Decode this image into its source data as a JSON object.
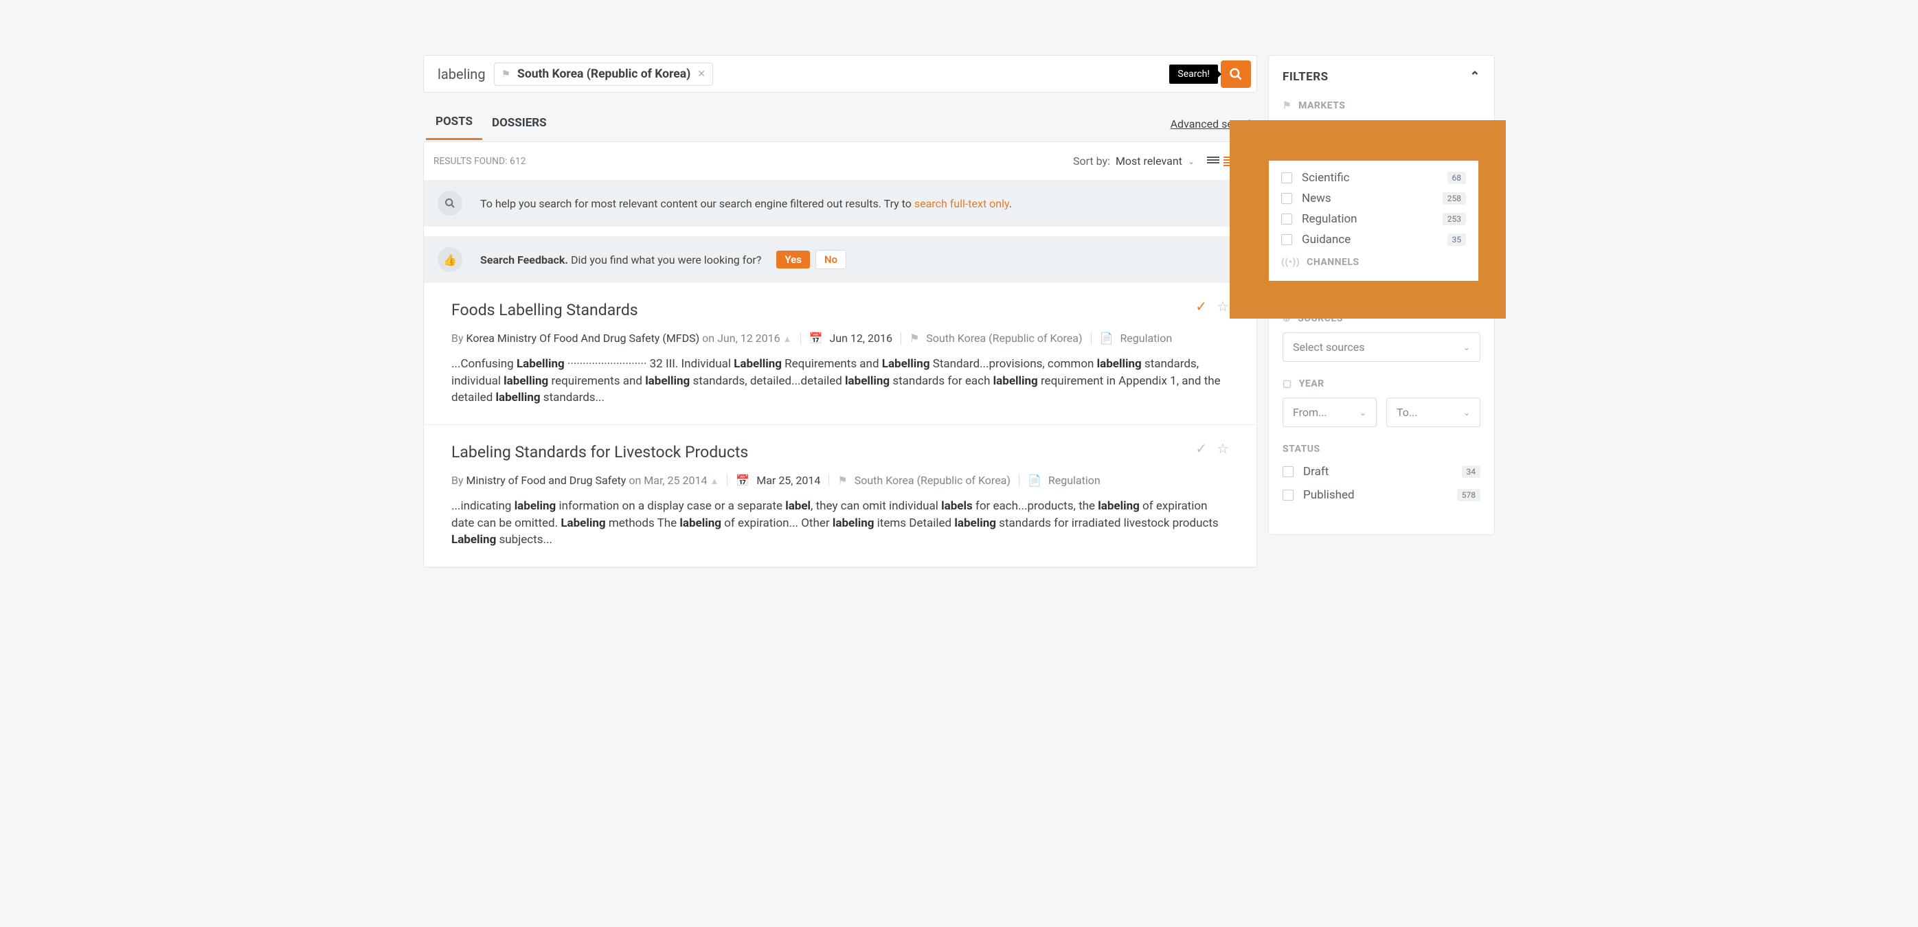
{
  "search": {
    "term": "labeling",
    "chip_label": "South Korea (Republic of Korea)",
    "tooltip": "Search!"
  },
  "tabs": {
    "posts": "POSTS",
    "dossiers": "DOSSIERS",
    "advanced": "Advanced search"
  },
  "results": {
    "found_prefix": "RESULTS FOUND: ",
    "found": "612",
    "sort_label": "Sort by:",
    "sort_value": "Most relevant"
  },
  "notice": {
    "text_a": "To help you search for most relevant content our search engine filtered out results. Try to ",
    "link": "search full-text only",
    "text_b": "."
  },
  "feedback": {
    "label_a": "Search Feedback. ",
    "label_b": "Did you find what you were looking for?",
    "yes": "Yes",
    "no": "No"
  },
  "r1": {
    "title": "Foods Labelling Standards",
    "by": "By ",
    "author": "Korea Ministry Of Food And Drug Safety (MFDS)",
    "on": " on Jun, 12 2016",
    "date": "Jun 12, 2016",
    "market": "South Korea (Republic of Korea)",
    "type": "Regulation",
    "snip": "...Confusing <b>Labelling</b> ·························· 32 III. Individual <b>Labelling</b> Requirements and <b>Labelling</b> Standard...provisions, common <b>labelling</b> standards, individual <b>labelling</b> requirements and <b>labelling</b> standards, detailed...detailed <b>labelling</b> standards for each <b>labelling</b> requirement in Appendix 1, and the detailed <b>labelling</b> standards..."
  },
  "r2": {
    "title": "Labeling Standards for Livestock Products",
    "by": "By ",
    "author": "Ministry of Food and Drug Safety",
    "on": " on Mar, 25 2014",
    "date": "Mar 25, 2014",
    "market": "South Korea (Republic of Korea)",
    "type": "Regulation",
    "snip": "...indicating <b>labeling</b> information on a display case or a separate <b>label</b>, they can omit individual <b>labels</b> for each...products, the <b>labeling</b> of expiration date can be omitted. <b>Labeling</b> methods The <b>labeling</b> of expiration... Other <b>labeling</b> items Detailed <b>labeling</b> standards for irradiated livestock products <b>Labeling</b> subjects..."
  },
  "filters": {
    "title": "FILTERS",
    "markets": "MARKETS",
    "sources": "SOURCES",
    "sources_ph": "Select sources",
    "year": "YEAR",
    "from": "From...",
    "to": "To...",
    "status": "STATUS",
    "draft": "Draft",
    "draft_n": "34",
    "published": "Published",
    "published_n": "578",
    "channels": "CHANNELS",
    "sci": "Scientific",
    "sci_n": "68",
    "news": "News",
    "news_n": "258",
    "reg": "Regulation",
    "reg_n": "253",
    "guid": "Guidance",
    "guid_n": "35"
  }
}
